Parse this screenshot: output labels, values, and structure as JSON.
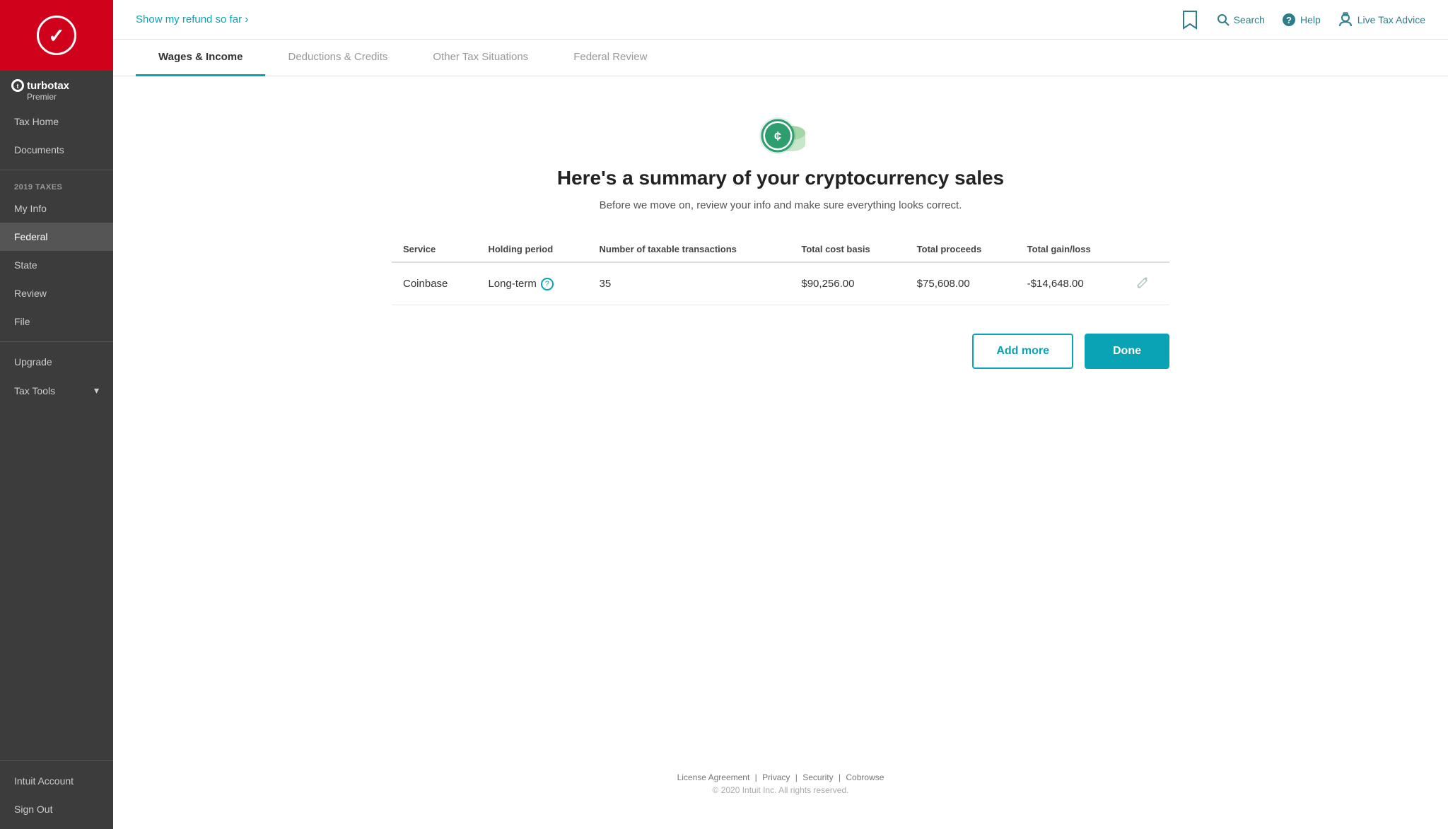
{
  "sidebar": {
    "logo_check": "✓",
    "brand_name": "turbotax",
    "brand_tier": "Premier",
    "section_label": "2019 TAXES",
    "nav_items": [
      {
        "id": "tax-home",
        "label": "Tax Home",
        "active": false
      },
      {
        "id": "documents",
        "label": "Documents",
        "active": false
      }
    ],
    "tax_nav_items": [
      {
        "id": "my-info",
        "label": "My Info",
        "active": false
      },
      {
        "id": "federal",
        "label": "Federal",
        "active": true
      },
      {
        "id": "state",
        "label": "State",
        "active": false
      },
      {
        "id": "review",
        "label": "Review",
        "active": false
      },
      {
        "id": "file",
        "label": "File",
        "active": false
      }
    ],
    "bottom_items": [
      {
        "id": "upgrade",
        "label": "Upgrade",
        "active": false
      },
      {
        "id": "tax-tools",
        "label": "Tax Tools",
        "active": false,
        "chevron": true
      }
    ],
    "footer_items": [
      {
        "id": "intuit-account",
        "label": "Intuit Account"
      },
      {
        "id": "sign-out",
        "label": "Sign Out"
      }
    ]
  },
  "topbar": {
    "refund_label": "Show my refund so far",
    "refund_arrow": "›",
    "bookmark_title": "Bookmark",
    "search_label": "Search",
    "help_label": "Help",
    "live_advice_label": "Live Tax Advice"
  },
  "tabs": [
    {
      "id": "wages-income",
      "label": "Wages & Income",
      "active": true
    },
    {
      "id": "deductions-credits",
      "label": "Deductions & Credits",
      "active": false
    },
    {
      "id": "other-tax-situations",
      "label": "Other Tax Situations",
      "active": false
    },
    {
      "id": "federal-review",
      "label": "Federal Review",
      "active": false
    }
  ],
  "page": {
    "title": "Here's a summary of your cryptocurrency sales",
    "subtitle": "Before we move on, review your info and make sure everything looks correct."
  },
  "table": {
    "headers": [
      "Service",
      "Holding period",
      "Number of taxable transactions",
      "Total cost basis",
      "Total proceeds",
      "Total gain/loss",
      ""
    ],
    "rows": [
      {
        "service": "Coinbase",
        "holding_period": "Long-term",
        "transactions": "35",
        "cost_basis": "$90,256.00",
        "proceeds": "$75,608.00",
        "gain_loss": "-$14,648.00"
      }
    ]
  },
  "buttons": {
    "add_more": "Add more",
    "done": "Done"
  },
  "footer": {
    "links": [
      "License Agreement",
      "Privacy",
      "Security",
      "Cobrowse"
    ],
    "copyright": "© 2020 Intuit Inc. All rights reserved."
  }
}
